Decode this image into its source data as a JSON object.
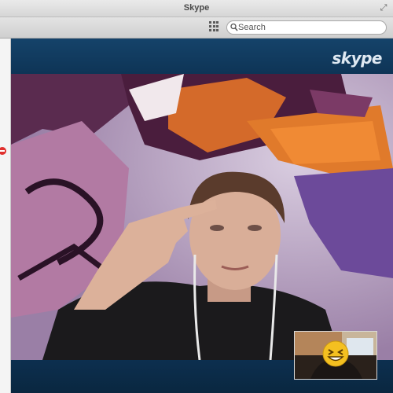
{
  "window": {
    "title": "Skype"
  },
  "toolbar": {
    "dialpad_icon": "dialpad-icon",
    "search": {
      "placeholder": "Search",
      "value": "",
      "icon": "search-icon"
    }
  },
  "sidebar": {
    "badge_icon": "minus-icon"
  },
  "call": {
    "logo_text": "skype",
    "remote_video": "remote-video-feed",
    "self_preview_emoticon": "laughing-emoticon"
  },
  "colors": {
    "call_background": "#0d3151",
    "header": "#15436a",
    "badge": "#e0302d",
    "emoticon": "#f4c020"
  }
}
